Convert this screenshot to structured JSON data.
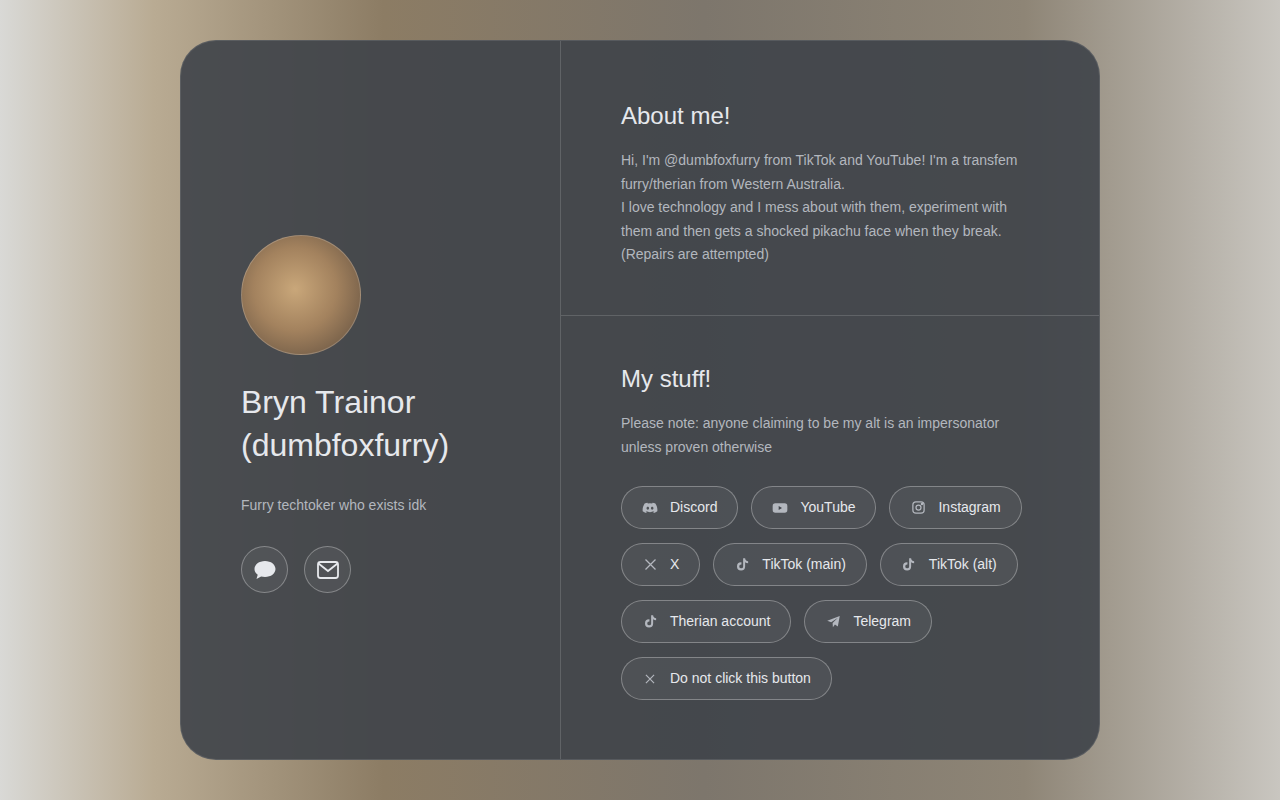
{
  "profile": {
    "name": "Bryn Trainor (dumbfoxfurry)",
    "tagline": "Furry techtoker who exists idk"
  },
  "about": {
    "title": "About me!",
    "paragraphs": [
      "Hi, I'm @dumbfoxfurry from TikTok and YouTube! I'm a transfem furry/therian from Western Australia.",
      "I love technology and I mess about with them, experiment with them and then gets a shocked pikachu face when they break.",
      "(Repairs are attempted)"
    ]
  },
  "links": {
    "title": "My stuff!",
    "note": "Please note: anyone claiming to be my alt is an impersonator unless proven otherwise",
    "buttons": [
      {
        "label": "Discord",
        "kind": "discord"
      },
      {
        "label": "YouTube",
        "kind": "youtube"
      },
      {
        "label": "Instagram",
        "kind": "instagram"
      },
      {
        "label": "X",
        "kind": "x"
      },
      {
        "label": "TikTok (main)",
        "kind": "tiktok"
      },
      {
        "label": "TikTok (alt)",
        "kind": "tiktok"
      },
      {
        "label": "Therian account",
        "kind": "tiktok"
      },
      {
        "label": "Telegram",
        "kind": "telegram"
      },
      {
        "label": "Do not click this button",
        "kind": "close"
      }
    ]
  }
}
